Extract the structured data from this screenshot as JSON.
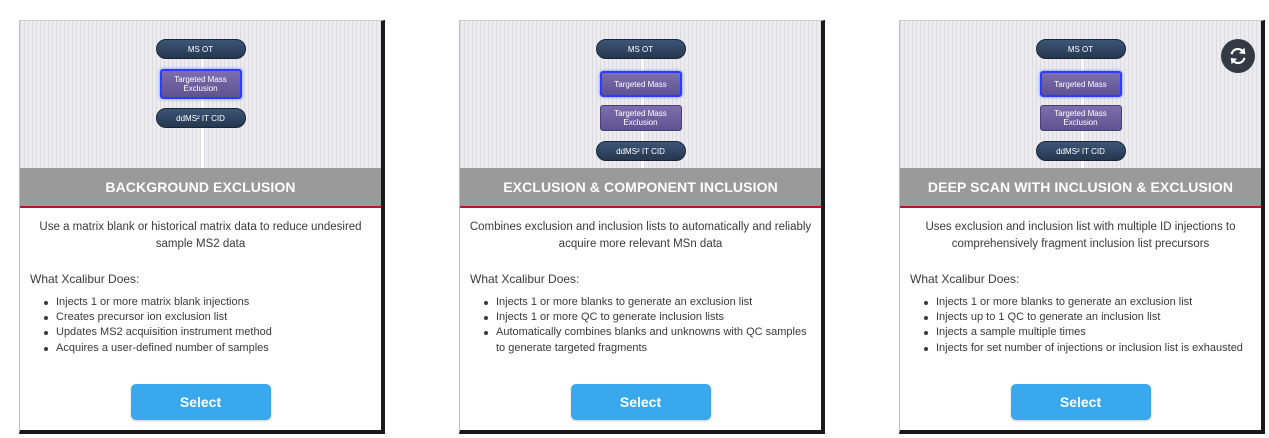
{
  "cards": [
    {
      "diagram": [
        "MS OT",
        "Targeted Mass Exclusion",
        "ddMS² IT CID"
      ],
      "title": "BACKGROUND EXCLUSION",
      "description": "Use a matrix blank or historical matrix data to reduce undesired sample MS2 data",
      "does_title": "What Xcalibur Does:",
      "bullets": [
        "Injects 1 or more matrix blank injections",
        "Creates precursor ion exclusion list",
        "Updates MS2 acquisition instrument method",
        "Acquires a user-defined number of samples"
      ],
      "select_label": "Select"
    },
    {
      "diagram": [
        "MS OT",
        "Targeted Mass",
        "Targeted Mass Exclusion",
        "ddMS² IT CID"
      ],
      "title": "EXCLUSION & COMPONENT INCLUSION",
      "description": "Combines exclusion and inclusion lists to automatically and reliably acquire more relevant MSn data",
      "does_title": "What Xcalibur Does:",
      "bullets": [
        "Injects 1 or more blanks to generate an exclusion list",
        "Injects 1 or more QC to generate inclusion lists",
        "Automatically combines blanks and unknowns with QC samples to generate targeted fragments"
      ],
      "select_label": "Select"
    },
    {
      "diagram": [
        "MS OT",
        "Targeted Mass",
        "Targeted Mass Exclusion",
        "ddMS² IT CID"
      ],
      "title": "DEEP SCAN WITH INCLUSION & EXCLUSION",
      "description": "Uses exclusion and inclusion list with multiple ID injections to comprehensively fragment inclusion list precursors",
      "does_title": "What Xcalibur Does:",
      "bullets": [
        "Injects 1 or more blanks to generate an exclusion list",
        "Injects up to 1 QC to generate an inclusion list",
        "Injects a sample multiple times",
        "Injects for set number of injections or inclusion list is exhausted"
      ],
      "select_label": "Select",
      "refresh_icon": "refresh-icon"
    }
  ],
  "colors": {
    "banner": "#9a9a9a",
    "banner_underline": "#c8102e",
    "select_button": "#3aa8ec",
    "pill_node": "#2f4564",
    "rect_node": "#6a5f9e",
    "selected_outline": "#2b3cff"
  }
}
